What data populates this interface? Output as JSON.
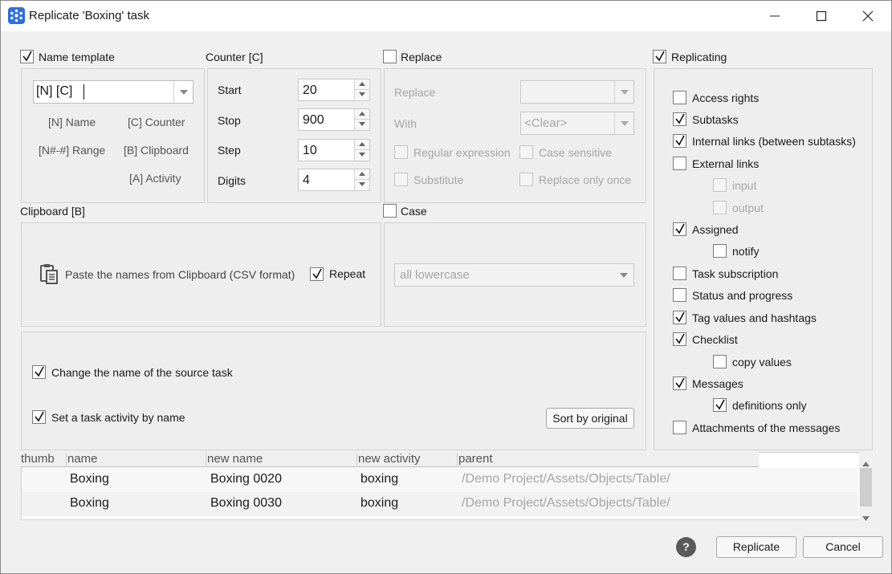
{
  "window": {
    "title": "Replicate 'Boxing' task"
  },
  "name_template": {
    "label": "Name template",
    "checked": true,
    "value": "[N] [C]",
    "tokens": [
      "[N] Name",
      "[C] Counter",
      "[N#-#] Range",
      "[B] Clipboard",
      "[A] Activity"
    ]
  },
  "counter": {
    "label": "Counter [C]",
    "start_label": "Start",
    "start": "20",
    "stop_label": "Stop",
    "stop": "900",
    "step_label": "Step",
    "step": "10",
    "digits_label": "Digits",
    "digits": "4"
  },
  "replace": {
    "label": "Replace",
    "checked": false,
    "replace_label": "Replace",
    "replace_value": "",
    "with_label": "With",
    "with_value": "<Clear>",
    "regex_label": "Regular expression",
    "case_sensitive_label": "Case sensitive",
    "substitute_label": "Substitute",
    "replace_once_label": "Replace only once"
  },
  "clipboard": {
    "label": "Clipboard [B]",
    "paste_label": "Paste the names from Clipboard (CSV format)",
    "repeat_label": "Repeat",
    "repeat_checked": true
  },
  "case": {
    "label": "Case",
    "checked": false,
    "value": "all lowercase"
  },
  "options": {
    "change_name_label": "Change the name of the source task",
    "change_name_checked": true,
    "set_activity_label": "Set a task activity by name",
    "set_activity_checked": true,
    "sort_button": "Sort by original"
  },
  "replicating": {
    "label": "Replicating",
    "checked": true,
    "items": [
      {
        "label": "Access rights",
        "checked": false,
        "indent": 0,
        "enabled": true
      },
      {
        "label": "Subtasks",
        "checked": true,
        "indent": 0,
        "enabled": true
      },
      {
        "label": "Internal links (between subtasks)",
        "checked": true,
        "indent": 0,
        "enabled": true
      },
      {
        "label": "External links",
        "checked": false,
        "indent": 0,
        "enabled": true
      },
      {
        "label": "input",
        "checked": false,
        "indent": 1,
        "enabled": false
      },
      {
        "label": "output",
        "checked": false,
        "indent": 1,
        "enabled": false
      },
      {
        "label": "Assigned",
        "checked": true,
        "indent": 0,
        "enabled": true
      },
      {
        "label": "notify",
        "checked": false,
        "indent": 1,
        "enabled": true
      },
      {
        "label": "Task subscription",
        "checked": false,
        "indent": 0,
        "enabled": true
      },
      {
        "label": "Status and progress",
        "checked": false,
        "indent": 0,
        "enabled": true
      },
      {
        "label": "Tag values and hashtags",
        "checked": true,
        "indent": 0,
        "enabled": true
      },
      {
        "label": "Checklist",
        "checked": true,
        "indent": 0,
        "enabled": true
      },
      {
        "label": "copy values",
        "checked": false,
        "indent": 1,
        "enabled": true
      },
      {
        "label": "Messages",
        "checked": true,
        "indent": 0,
        "enabled": true
      },
      {
        "label": "definitions only",
        "checked": true,
        "indent": 1,
        "enabled": true
      },
      {
        "label": "Attachments of the messages",
        "checked": false,
        "indent": 0,
        "enabled": true
      }
    ]
  },
  "table": {
    "columns": [
      "thumb",
      "name",
      "new name",
      "new activity",
      "parent"
    ],
    "rows": [
      {
        "thumb": "",
        "name": "Boxing",
        "new_name": "Boxing 0020",
        "new_activity": "boxing",
        "parent": "/Demo Project/Assets/Objects/Table/"
      },
      {
        "thumb": "",
        "name": "Boxing",
        "new_name": "Boxing 0030",
        "new_activity": "boxing",
        "parent": "/Demo Project/Assets/Objects/Table/"
      }
    ]
  },
  "footer": {
    "help": "?",
    "replicate_button": "Replicate",
    "cancel_button": "Cancel"
  },
  "colors": {
    "accent": "#2c6fe0",
    "dialog_bg": "#f0f0f0",
    "panel_bg": "#eeeeee",
    "disabled_text": "#a6a6a6"
  }
}
